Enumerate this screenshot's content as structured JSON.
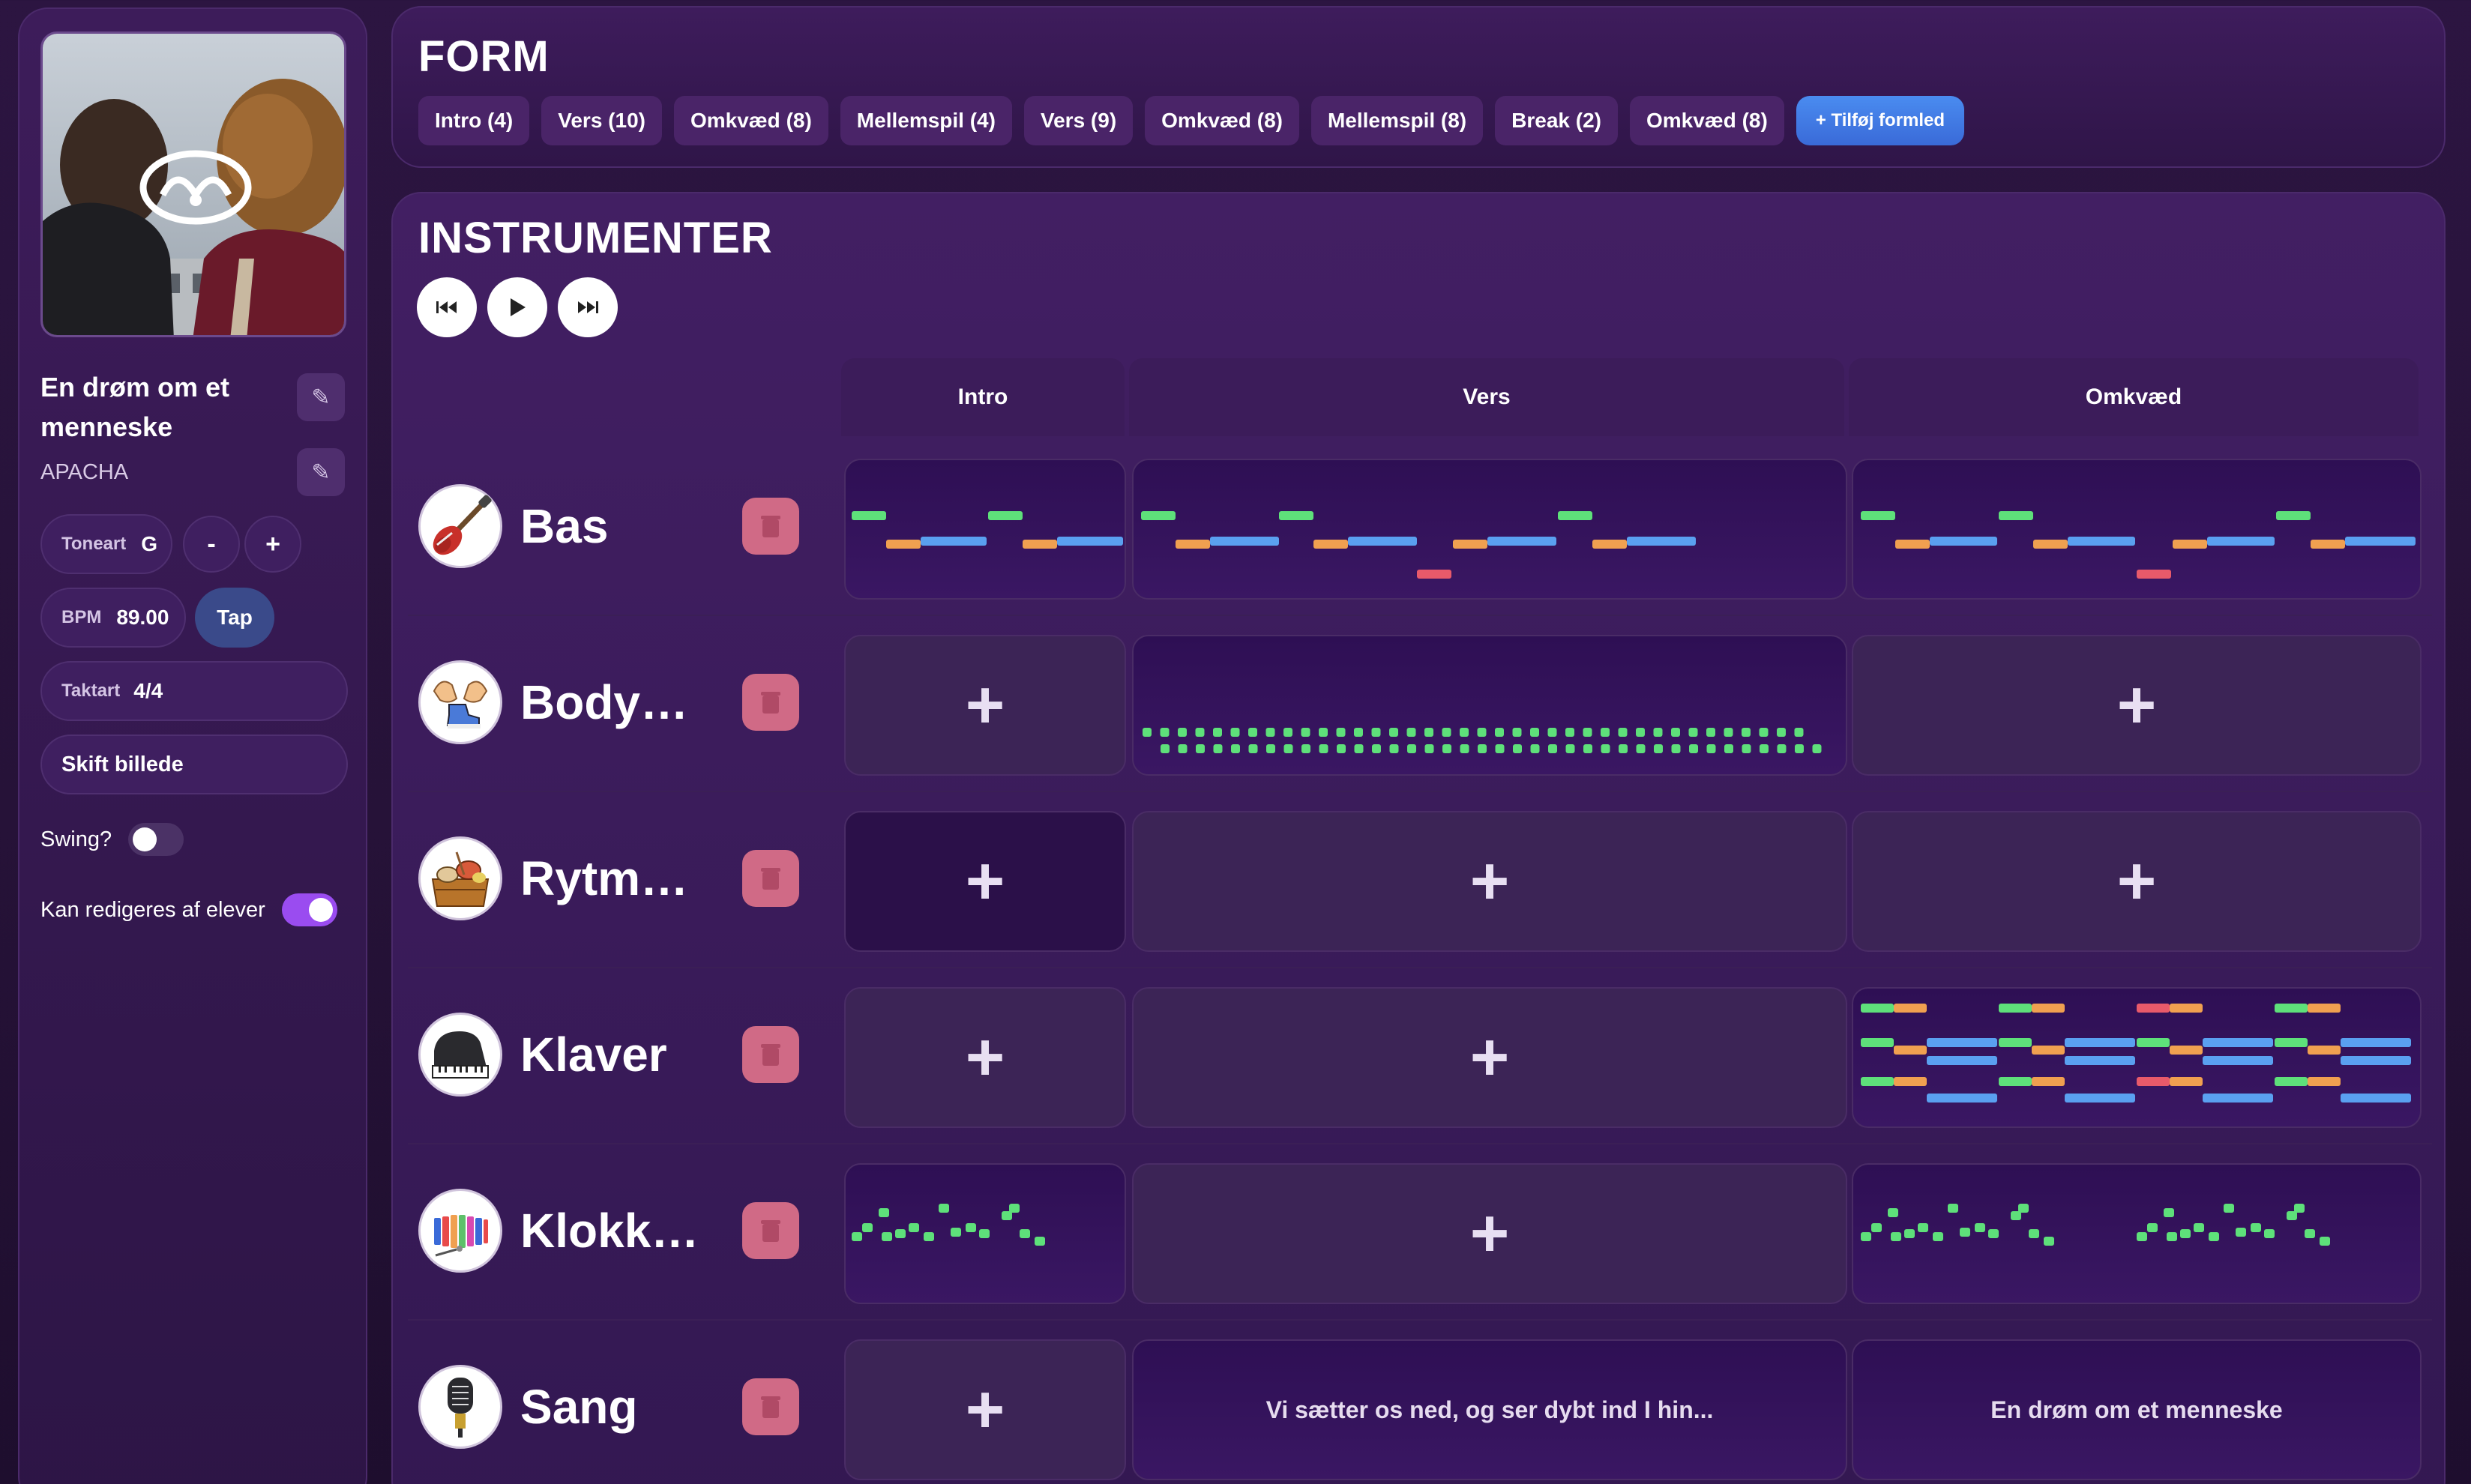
{
  "song": {
    "title": "En drøm om et menneske",
    "artist": "APACHA",
    "key_label": "Toneart",
    "key_value": "G",
    "minus_label": "-",
    "plus_label": "+",
    "bpm_label": "BPM",
    "bpm_value": "89.00",
    "tap_label": "Tap",
    "time_sig_label": "Taktart",
    "time_sig_value": "4/4",
    "change_image_label": "Skift billede",
    "swing_label": "Swing?",
    "swing_on": false,
    "editable_label": "Kan redigeres af elever",
    "editable_on": true
  },
  "form": {
    "title": "FORM",
    "parts": [
      "Intro (4)",
      "Vers (10)",
      "Omkvæd (8)",
      "Mellemspil (4)",
      "Vers (9)",
      "Omkvæd (8)",
      "Mellemspil (8)",
      "Break (2)",
      "Omkvæd (8)"
    ],
    "add_label": "+ Tilføj formled"
  },
  "instruments": {
    "title": "INSTRUMENTER",
    "columns": [
      "Intro",
      "Vers",
      "Omkvæd"
    ],
    "rows": [
      {
        "name": "Bas",
        "icon": "bass-guitar-icon",
        "cells": [
          "notes",
          "notes",
          "notes"
        ]
      },
      {
        "name": "Body…",
        "icon": "body-percussion-icon",
        "cells": [
          "empty",
          "notes",
          "empty"
        ]
      },
      {
        "name": "Rytm…",
        "icon": "rhythm-instruments-icon",
        "cells": [
          "empty",
          "empty",
          "empty"
        ]
      },
      {
        "name": "Klaver",
        "icon": "piano-icon",
        "cells": [
          "empty",
          "empty",
          "notes"
        ]
      },
      {
        "name": "Klokk…",
        "icon": "glockenspiel-icon",
        "cells": [
          "notes",
          "empty",
          "notes"
        ]
      },
      {
        "name": "Sang",
        "icon": "microphone-icon",
        "cells": [
          "empty",
          "Vi sætter os ned, og ser dybt ind I hin...",
          "En drøm om et menneske"
        ]
      }
    ],
    "add_cell_label": "+"
  },
  "colors": {
    "green": "#5ee07a",
    "orange": "#f0a050",
    "blue": "#5aa0f0",
    "red": "#e85a6a",
    "accent_purple": "#9a4cf0",
    "trash_pink": "#d06a86"
  }
}
